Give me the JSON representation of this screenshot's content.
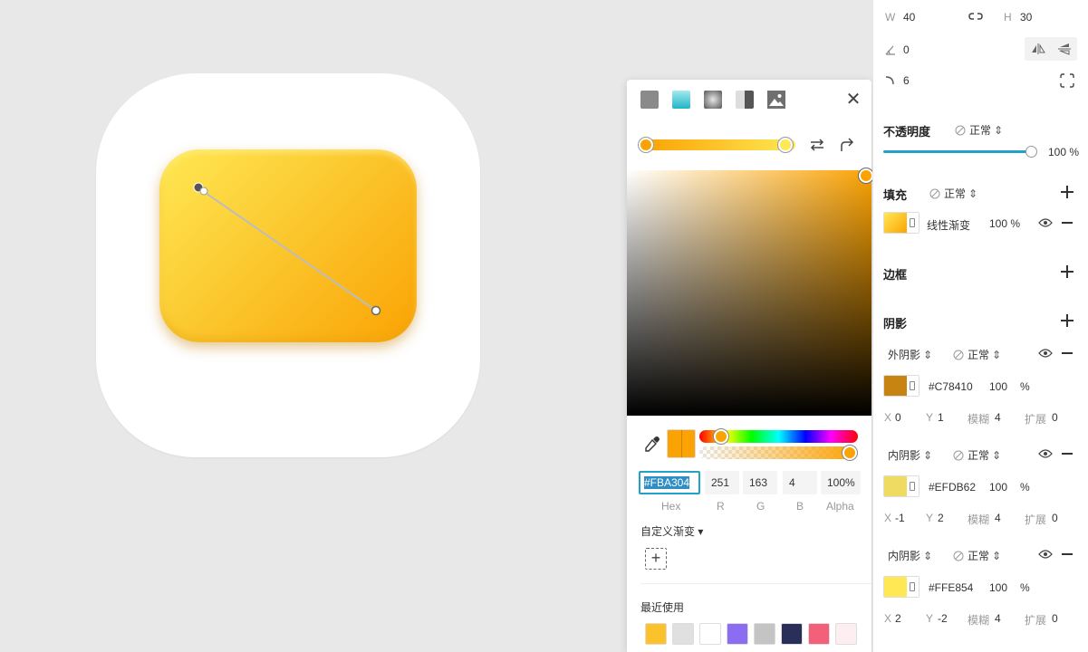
{
  "picker": {
    "tabs": [
      "solid-fill",
      "linear-gradient",
      "radial-gradient",
      "angular-gradient",
      "image-fill"
    ],
    "hex": "#FBA304",
    "r": "251",
    "g": "163",
    "b": "4",
    "alpha": "100",
    "alpha_unit": "%",
    "labels": {
      "hex": "Hex",
      "r": "R",
      "g": "G",
      "b": "B",
      "alpha": "Alpha"
    },
    "custom_gradient_label": "自定义渐变 ▾",
    "recent_label": "最近使用",
    "recent_colors": [
      "#fcc22c",
      "#e0e0e0",
      "#ffffff",
      "#8c6cf3",
      "#c4c4c4",
      "#2a2f5a",
      "#f4607a",
      "#fdeef2"
    ],
    "stop_colors": [
      "#fba304",
      "#ffe854"
    ]
  },
  "panel": {
    "w_label": "W",
    "w_value": "40",
    "h_label": "H",
    "h_value": "30",
    "angle_value": "0",
    "radius_value": "6",
    "opacity": {
      "title": "不透明度",
      "mode": "正常",
      "value": "100",
      "unit": "%",
      "level": 1.0
    },
    "fill": {
      "title": "填充",
      "mode": "正常",
      "item_label": "线性渐变",
      "item_value": "100",
      "item_unit": "%"
    },
    "border": {
      "title": "边框"
    },
    "shadow": {
      "title": "阴影",
      "x_label": "X",
      "y_label": "Y",
      "blur_label": "模糊",
      "spread_label": "扩展",
      "items": [
        {
          "type": "外阴影",
          "mode": "正常",
          "hex": "#C78410",
          "opacity": "100",
          "unit": "%",
          "x": "0",
          "y": "1",
          "blur": "4",
          "spread": "0",
          "color": "#c78410"
        },
        {
          "type": "内阴影",
          "mode": "正常",
          "hex": "#EFDB62",
          "opacity": "100",
          "unit": "%",
          "x": "-1",
          "y": "2",
          "blur": "4",
          "spread": "0",
          "color": "#efdb62"
        },
        {
          "type": "内阴影",
          "mode": "正常",
          "hex": "#FFE854",
          "opacity": "100",
          "unit": "%",
          "x": "2",
          "y": "-2",
          "blur": "4",
          "spread": "0",
          "color": "#ffe854"
        }
      ]
    }
  },
  "colors": {
    "accent": "#21a0c8",
    "selected_color": "#fba304"
  }
}
